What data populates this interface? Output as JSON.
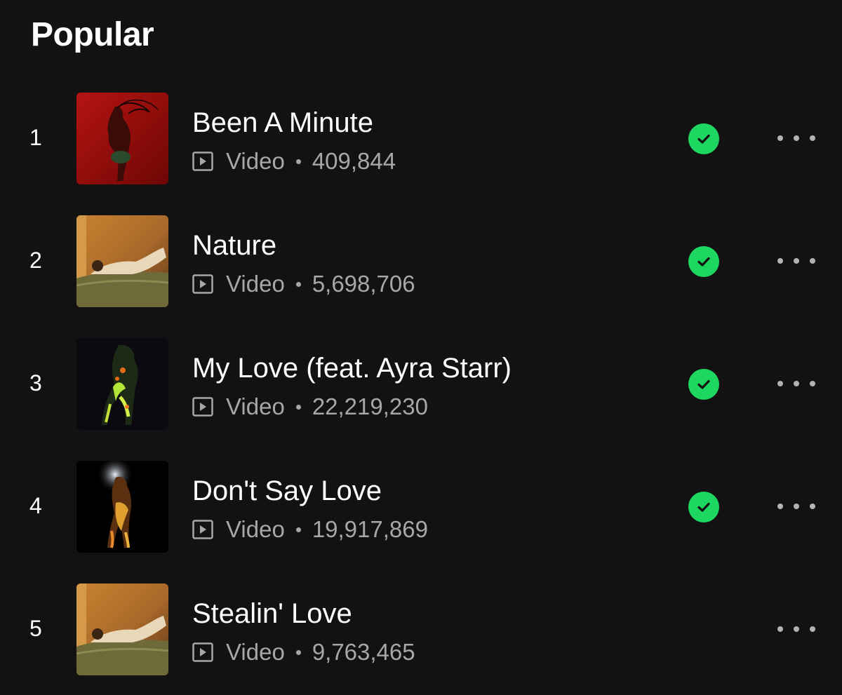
{
  "section": {
    "title": "Popular"
  },
  "meta_type_label": "Video",
  "colors": {
    "background": "#121212",
    "accent_green": "#1ed760",
    "secondary_text": "#a7a7a7"
  },
  "tracks": [
    {
      "index": "1",
      "title": "Been A Minute",
      "type": "Video",
      "plays": "409,844",
      "saved": true
    },
    {
      "index": "2",
      "title": "Nature",
      "type": "Video",
      "plays": "5,698,706",
      "saved": true
    },
    {
      "index": "3",
      "title": "My Love (feat. Ayra Starr)",
      "type": "Video",
      "plays": "22,219,230",
      "saved": true
    },
    {
      "index": "4",
      "title": "Don't Say Love",
      "type": "Video",
      "plays": "19,917,869",
      "saved": true
    },
    {
      "index": "5",
      "title": "Stealin' Love",
      "type": "Video",
      "plays": "9,763,465",
      "saved": false
    }
  ],
  "icons": {
    "saved": "check-circle-icon",
    "more": "more-options-icon",
    "video": "video-play-icon"
  }
}
